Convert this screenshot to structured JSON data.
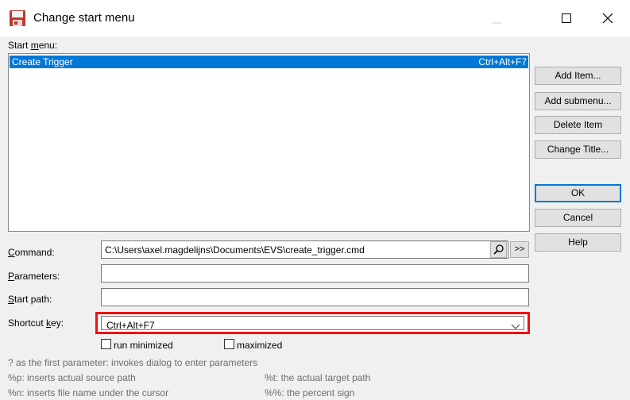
{
  "window": {
    "title": "Change start menu",
    "icons": {
      "app": "floppy-disk-icon",
      "minimize": "minimize-icon",
      "maximize": "maximize-icon",
      "close": "close-icon"
    }
  },
  "start_menu": {
    "label_prefix": "Start ",
    "label_mnemonic": "m",
    "label_rest": "enu:",
    "items": [
      {
        "name": "Create Trigger",
        "shortcut": "Ctrl+Alt+F7",
        "selected": true
      }
    ]
  },
  "buttons": {
    "add_item": "Add Item...",
    "add_submenu": "Add submenu...",
    "delete_item": "Delete Item",
    "change_title": "Change Title...",
    "ok": "OK",
    "cancel": "Cancel",
    "help": "Help"
  },
  "form": {
    "command": {
      "mnemonic": "C",
      "rest": "ommand:",
      "value": "C:\\Users\\axel.magdelijns\\Documents\\EVS\\create_trigger.cmd",
      "browse_icon": "search-icon",
      "more_label": ">>"
    },
    "parameters": {
      "mnemonic": "P",
      "rest": "arameters:",
      "value": ""
    },
    "start_path": {
      "mnemonic": "S",
      "rest": "tart path:",
      "value": ""
    },
    "shortcut_key": {
      "prefix": "Shortcut ",
      "mnemonic": "k",
      "rest": "ey:",
      "value": "Ctrl+Alt+F7",
      "chevron_icon": "chevron-down-icon",
      "highlight_color": "#e11111"
    }
  },
  "options": {
    "run_minimized": {
      "label": "run minimized",
      "checked": false
    },
    "maximized": {
      "label": "maximized",
      "checked": false
    }
  },
  "help_text": {
    "line1": "? as the first parameter: invokes dialog to enter parameters",
    "line2_left": "%p: inserts actual source path",
    "line2_right": "%t: the actual target path",
    "line3_left": "%n: inserts file name under the cursor",
    "line3_right": "%%: the percent sign"
  },
  "colors": {
    "selection": "#0078d7",
    "dialog_bg": "#f0f0f0",
    "hint_text": "#6d6d6d"
  }
}
